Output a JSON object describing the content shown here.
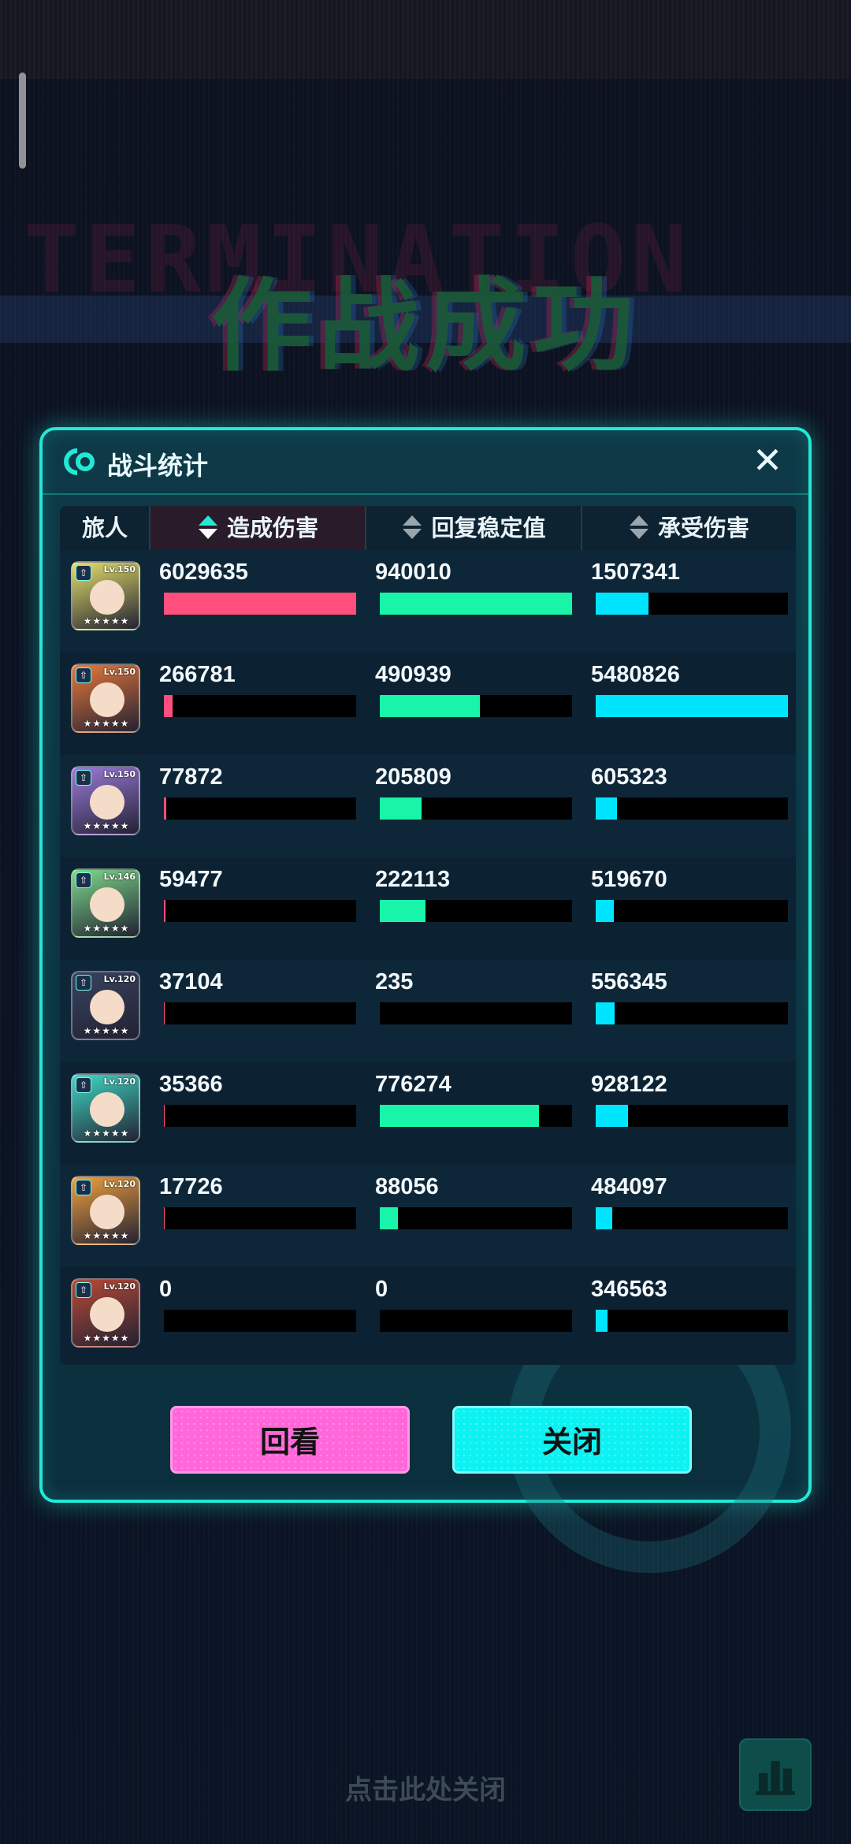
{
  "background": {
    "ghost_text": "TERMINATION",
    "mission_title": "作战成功"
  },
  "modal": {
    "title": "战斗统计",
    "close_symbol": "✕",
    "accent_color": "#23e8d5"
  },
  "table": {
    "headers": {
      "character": "旅人",
      "damage": "造成伤害",
      "heal": "回复稳定值",
      "taken": "承受伤害"
    },
    "rows": [
      {
        "level": "Lv.150",
        "stars": "★★★★★",
        "portrait_color": "#e6df6a",
        "damage": "6029635",
        "damage_ratio": 1.0,
        "heal": "940010",
        "heal_ratio": 1.0,
        "taken": "1507341",
        "taken_ratio": 0.275
      },
      {
        "level": "Lv.150",
        "stars": "★★★★★",
        "portrait_color": "#e8783a",
        "damage": "266781",
        "damage_ratio": 0.044,
        "heal": "490939",
        "heal_ratio": 0.522,
        "taken": "5480826",
        "taken_ratio": 1.0
      },
      {
        "level": "Lv.150",
        "stars": "★★★★★",
        "portrait_color": "#9d7ad9",
        "damage": "77872",
        "damage_ratio": 0.013,
        "heal": "205809",
        "heal_ratio": 0.219,
        "taken": "605323",
        "taken_ratio": 0.11
      },
      {
        "level": "Lv.146",
        "stars": "★★★★★",
        "portrait_color": "#7ed98a",
        "damage": "59477",
        "damage_ratio": 0.01,
        "heal": "222113",
        "heal_ratio": 0.236,
        "taken": "519670",
        "taken_ratio": 0.095
      },
      {
        "level": "Lv.120",
        "stars": "★★★★★",
        "portrait_color": "#37435e",
        "damage": "37104",
        "damage_ratio": 0.006,
        "heal": "235",
        "heal_ratio": 0.0,
        "taken": "556345",
        "taken_ratio": 0.1
      },
      {
        "level": "Lv.120",
        "stars": "★★★★★",
        "portrait_color": "#3fd8c4",
        "damage": "35366",
        "damage_ratio": 0.006,
        "heal": "776274",
        "heal_ratio": 0.826,
        "taken": "928122",
        "taken_ratio": 0.169
      },
      {
        "level": "Lv.120",
        "stars": "★★★★★",
        "portrait_color": "#f0a03e",
        "damage": "17726",
        "damage_ratio": 0.003,
        "heal": "88056",
        "heal_ratio": 0.094,
        "taken": "484097",
        "taken_ratio": 0.088
      },
      {
        "level": "Lv.120",
        "stars": "★★★★★",
        "portrait_color": "#b84a36",
        "damage": "0",
        "damage_ratio": 0.0,
        "heal": "0",
        "heal_ratio": 0.0,
        "taken": "346563",
        "taken_ratio": 0.063
      }
    ]
  },
  "buttons": {
    "replay": "回看",
    "close": "关闭"
  },
  "footer": {
    "tap_to_close": "点击此处关闭"
  }
}
